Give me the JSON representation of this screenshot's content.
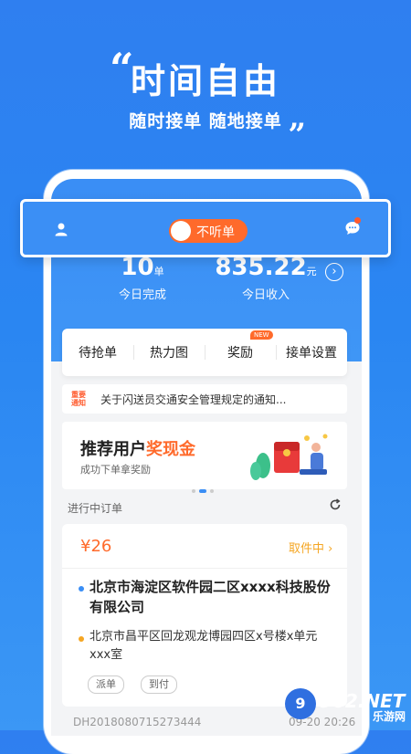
{
  "hero": {
    "quote_open": "“",
    "title": "时间自由",
    "subtitle": "随时接单 随地接单",
    "quote_close": "„"
  },
  "status_bar": {
    "toggle_label": "不听单",
    "accent": "#ff6a2b",
    "bg": "#3b8ff5"
  },
  "stats": {
    "orders_value": "10",
    "orders_unit": "单",
    "orders_label": "今日完成",
    "income_value": "835.22",
    "income_unit": "元",
    "income_label": "今日收入"
  },
  "menu": {
    "items": [
      "待抢单",
      "热力图",
      "奖励",
      "接单设置"
    ],
    "new_badge": "NEW"
  },
  "notice": {
    "tag_line1": "重要",
    "tag_line2": "通知",
    "text": "关于闪送员交通安全管理规定的通知..."
  },
  "banner": {
    "title_prefix": "推荐用户",
    "title_highlight": "奖现金",
    "subtitle": "成功下单拿奖励"
  },
  "orders_section": {
    "title": "进行中订单"
  },
  "order": {
    "price": "¥26",
    "status": "取件中 ›",
    "from": "北京市海淀区软件园二区xxxx科技股份有限公司",
    "to": "北京市昌平区回龙观龙博园四区x号楼x单元xxx室",
    "tags": [
      "派单",
      "到付"
    ],
    "number": "DH2018080715273444",
    "time": "09-20 20:26"
  },
  "watermark": {
    "badge": "9",
    "text": "962.NET",
    "sub": "乐游网"
  }
}
